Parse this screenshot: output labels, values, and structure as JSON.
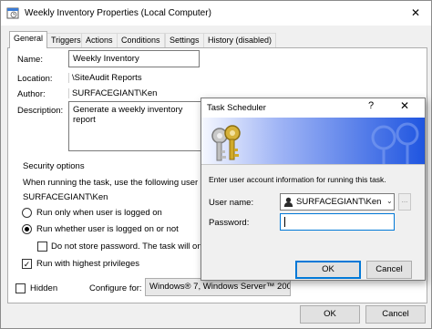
{
  "window": {
    "title": "Weekly Inventory Properties (Local Computer)",
    "close_glyph": "✕"
  },
  "tabs": [
    {
      "label": "General",
      "active": true
    },
    {
      "label": "Triggers"
    },
    {
      "label": "Actions"
    },
    {
      "label": "Conditions"
    },
    {
      "label": "Settings"
    },
    {
      "label": "History (disabled)"
    }
  ],
  "general": {
    "name_label": "Name:",
    "name_value": "Weekly Inventory",
    "location_label": "Location:",
    "location_value": "\\SiteAudit Reports",
    "author_label": "Author:",
    "author_value": "SURFACEGIANT\\Ken",
    "description_label": "Description:",
    "description_value": "Generate a weekly inventory report",
    "security_group_label": "Security options",
    "security_intro": "When running the task, use the following user ac",
    "security_user": "SURFACEGIANT\\Ken",
    "radio_logged_on_label": "Run only when user is logged on",
    "radio_whether_label": "Run whether user is logged on or not",
    "dont_store_label": "Do not store password.  The task will only h",
    "highest_priv_label": "Run with highest privileges",
    "hidden_label": "Hidden",
    "configure_label": "Configure for:",
    "configure_value": "Windows® 7, Windows Server™ 2008 R2",
    "ok_label": "OK",
    "cancel_label": "Cancel"
  },
  "dialog": {
    "title": "Task Scheduler",
    "help_glyph": "?",
    "close_glyph": "✕",
    "instruction": "Enter user account information for running this task.",
    "username_label": "User name:",
    "username_value": "SURFACEGIANT\\Ken",
    "password_label": "Password:",
    "password_value": "",
    "browse_label": "...",
    "ok_label": "OK",
    "cancel_label": "Cancel"
  }
}
